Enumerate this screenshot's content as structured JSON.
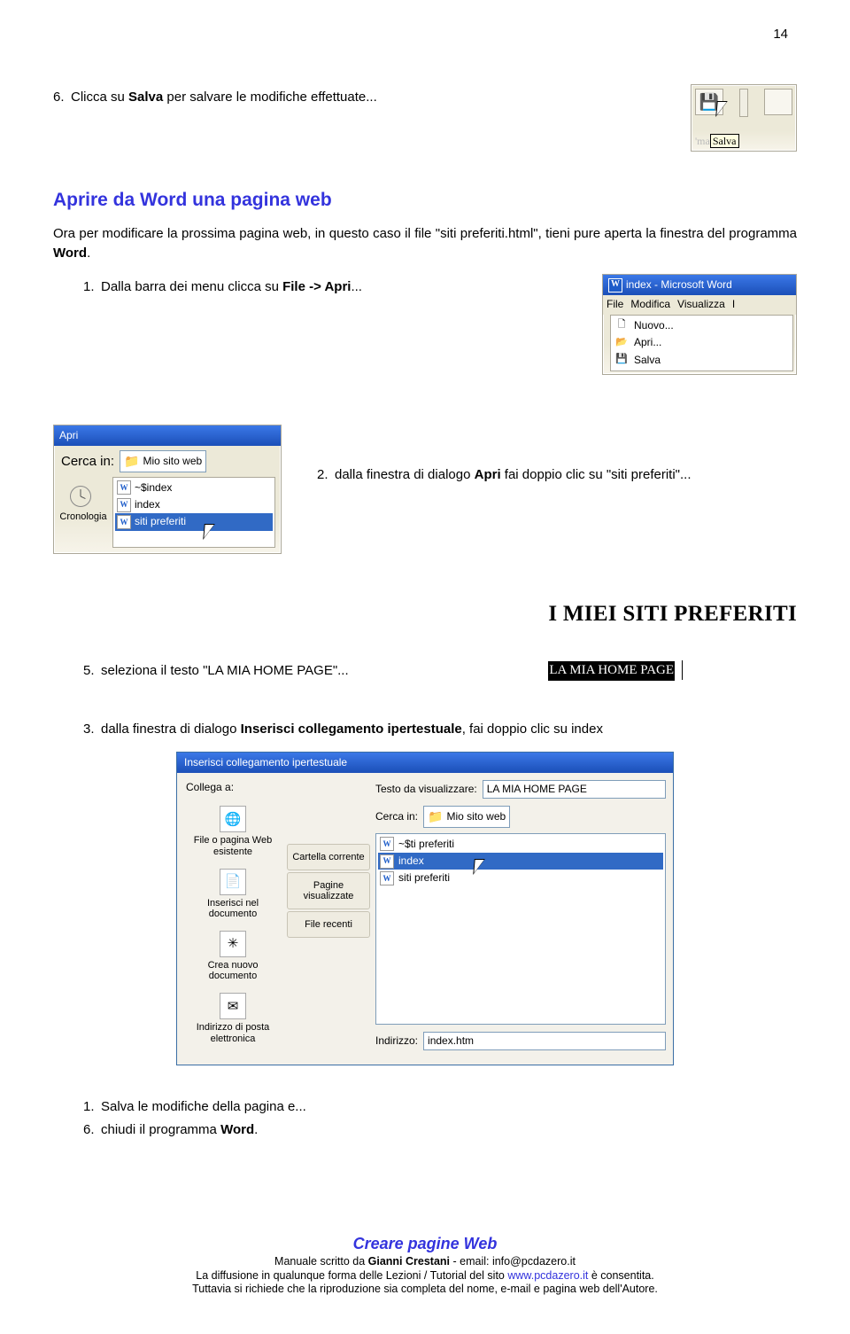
{
  "pageNumber": "14",
  "intro": {
    "num": "6.",
    "txt_before": "Clicca su ",
    "bold": "Salva",
    "txt_after": " per salvare le modifiche effettuate..."
  },
  "shot_save": {
    "label": "Salva"
  },
  "sectionTitle": "Aprire da Word una pagina web",
  "para1_a": "Ora per modificare la prossima pagina web, in questo caso il file \"siti preferiti.html\", tieni pure aperta la finestra del programma ",
  "para1_b": "Word",
  "para1_c": ".",
  "step1": {
    "num": "1.",
    "pre": "Dalla barra dei menu clicca su ",
    "bold": "File -> Apri",
    "post": "..."
  },
  "wordshot": {
    "title": "index - Microsoft Word",
    "menus": [
      "File",
      "Modifica",
      "Visualizza",
      "I"
    ],
    "items": [
      "Nuovo...",
      "Apri...",
      "Salva"
    ]
  },
  "apri": {
    "title": "Apri",
    "cercaLabel": "Cerca in:",
    "folder": "Mio sito web",
    "sideLabel": "Cronologia",
    "items": [
      "~$index",
      "index",
      "siti preferiti"
    ]
  },
  "step2": {
    "num": "2.",
    "pre": "dalla finestra di dialogo ",
    "bold": "Apri",
    "post": " fai doppio clic su \"siti preferiti\"..."
  },
  "step5": {
    "num": "5.",
    "txt": "seleziona il testo \"LA MIA HOME PAGE\"..."
  },
  "serifTitle": "I MIEI SITI PREFERITI",
  "serifSel": "LA MIA HOME PAGE",
  "step3": {
    "num": "3.",
    "pre": "dalla finestra di dialogo ",
    "bold": "Inserisci collegamento ipertestuale",
    "post": ", fai doppio clic su index"
  },
  "dlg": {
    "title": "Inserisci collegamento ipertestuale",
    "collegaLabel": "Collega a:",
    "testoLabel": "Testo da visualizzare:",
    "testoValue": "LA MIA HOME PAGE",
    "leftItems": [
      "File o pagina Web esistente",
      "Inserisci nel documento",
      "Crea nuovo documento",
      "Indirizzo di posta elettronica"
    ],
    "midItems": [
      "Cartella corrente",
      "Pagine visualizzate",
      "File recenti"
    ],
    "cercaLabel": "Cerca in:",
    "folder": "Mio sito web",
    "files": [
      "~$ti preferiti",
      "index",
      "siti preferiti"
    ],
    "indirizzoLabel": "Indirizzo:",
    "indirizzoValue": "index.htm"
  },
  "closing": {
    "s1num": "1.",
    "s1txt": "Salva le modifiche della pagina e...",
    "s6num": "6.",
    "s6txt_a": "chiudi il programma ",
    "s6txt_b": "Word",
    "s6txt_c": "."
  },
  "footer": {
    "title": "Creare pagine Web",
    "l1a": "Manuale scritto da ",
    "l1b": "Gianni Crestani",
    "l1c": " - email: info@pcdazero.it",
    "l2a": "La diffusione in qualunque forma delle Lezioni / Tutorial del sito ",
    "l2b": "www.pcdazero.it",
    "l2c": " è consentita.",
    "l3": "Tuttavia si richiede che la riproduzione sia completa del nome, e-mail e pagina web dell'Autore."
  }
}
